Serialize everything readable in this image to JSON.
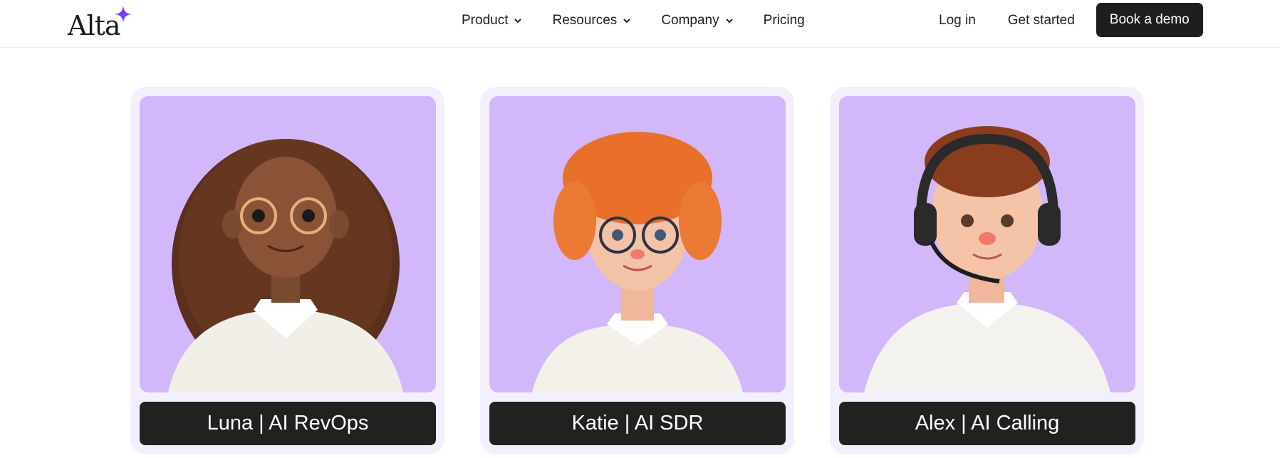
{
  "header": {
    "logo_text": "Alta",
    "nav": [
      {
        "label": "Product",
        "has_dropdown": true
      },
      {
        "label": "Resources",
        "has_dropdown": true
      },
      {
        "label": "Company",
        "has_dropdown": true
      },
      {
        "label": "Pricing",
        "has_dropdown": false
      }
    ],
    "login_label": "Log in",
    "get_started_label": "Get started",
    "demo_label": "Book a demo"
  },
  "colors": {
    "accent": "#7b3ff2",
    "card_bg": "#f4efff",
    "portrait_bg": "#d2b8fa",
    "label_bg": "#212121"
  },
  "cards": [
    {
      "name": "Luna | AI RevOps",
      "icon": "avatar-luna-image"
    },
    {
      "name": "Katie | AI SDR",
      "icon": "avatar-katie-image"
    },
    {
      "name": "Alex | AI Calling",
      "icon": "avatar-alex-image"
    }
  ]
}
